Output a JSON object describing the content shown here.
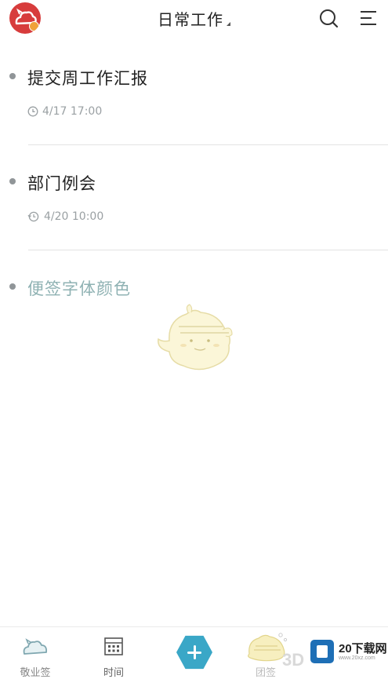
{
  "header": {
    "title": "日常工作",
    "avatar_icon": "cloud-mascot-avatar-icon",
    "search_icon": "search-icon",
    "menu_icon": "menu-icon"
  },
  "notes": [
    {
      "text": "提交周工作汇报",
      "time": "4/17 17:00",
      "time_icon": "clock-icon"
    },
    {
      "text": "部门例会",
      "time": "4/20 10:00",
      "time_icon": "repeat-clock-icon"
    },
    {
      "text": "便签字体颜色",
      "time": "",
      "text_color": "#8fb2b3"
    }
  ],
  "tabbar": {
    "tabs": [
      {
        "label": "敬业签",
        "icon": "cloud-icon"
      },
      {
        "label": "时间",
        "icon": "calendar-icon"
      },
      {
        "label": "",
        "icon": "add-icon"
      },
      {
        "label": "团签",
        "icon": "mascot-icon"
      }
    ]
  },
  "watermark": {
    "text": "20下载网",
    "sub": "www.20xz.com",
    "extra": "3D"
  },
  "colors": {
    "accent": "#3aa7c7",
    "avatar": "#d73c3c",
    "dot": "#909598",
    "meta": "#9aa0a3",
    "highlight_note": "#8fb2b3"
  }
}
